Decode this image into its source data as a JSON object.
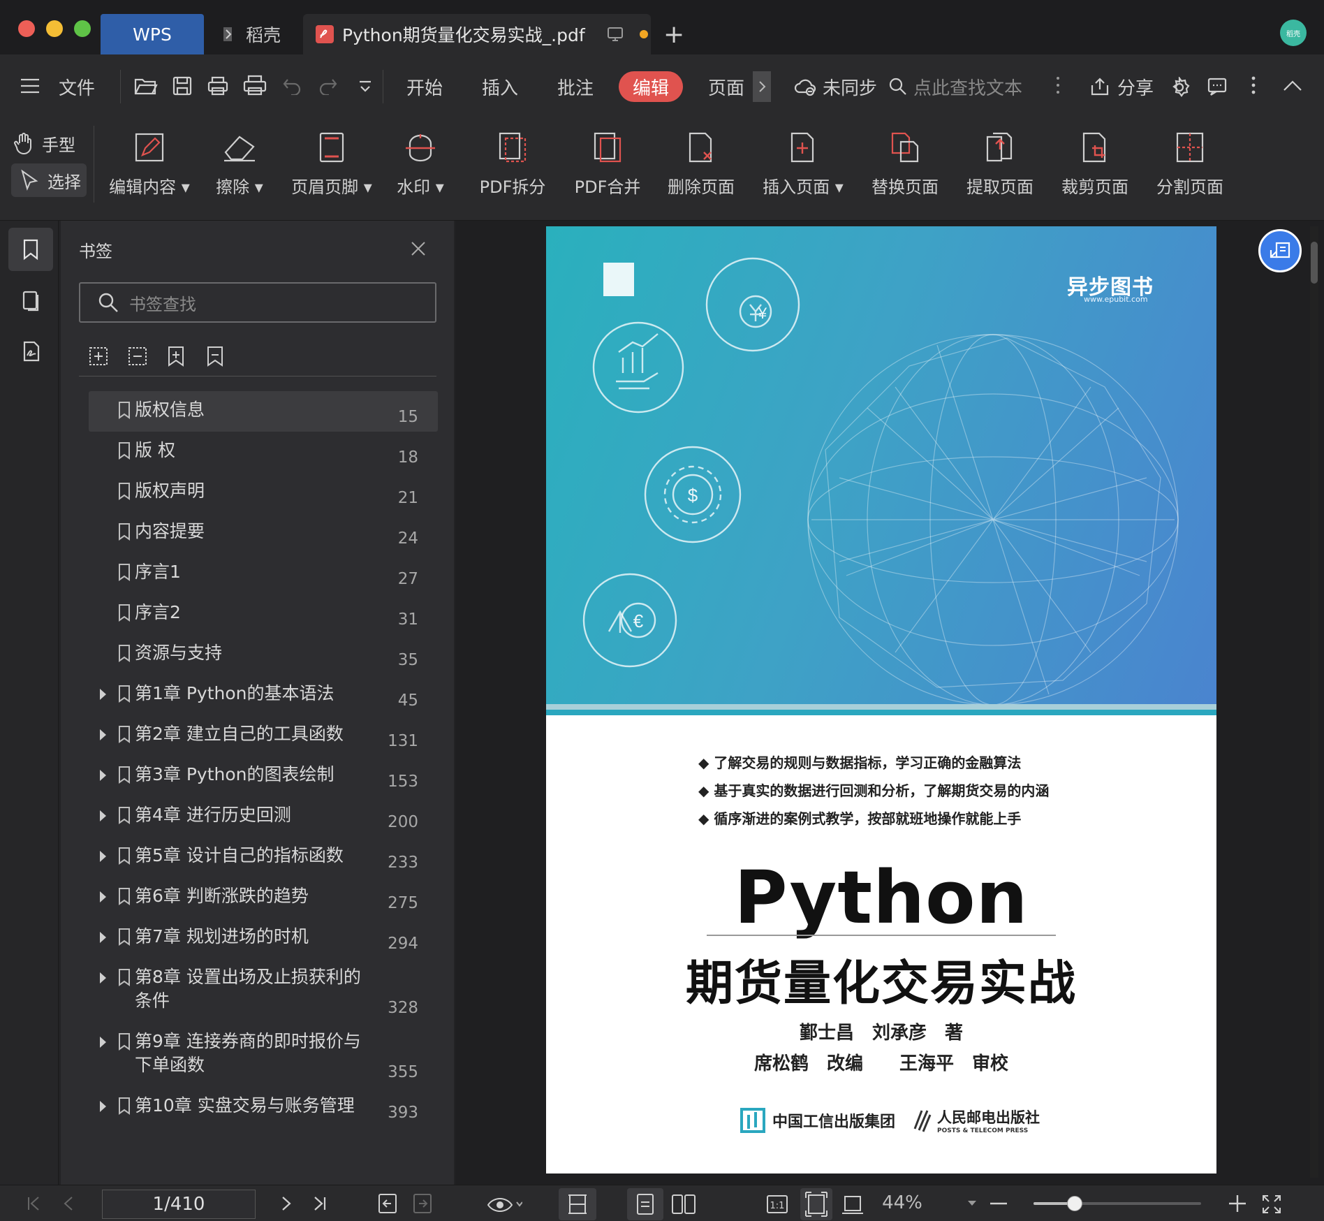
{
  "titlebar": {
    "tabs": [
      {
        "label": "WPS"
      },
      {
        "label": "稻壳"
      },
      {
        "label": "Python期货量化交易实战_.pdf"
      }
    ],
    "new_tab": "+",
    "avatar_text": "稻壳"
  },
  "menubar": {
    "file": "文件",
    "start": "开始",
    "insert": "插入",
    "comment": "批注",
    "edit": "编辑",
    "page": "页面",
    "sync": "未同步",
    "search_placeholder": "点此查找文本",
    "share": "分享"
  },
  "ribbon": {
    "hand": "手型",
    "select": "选择",
    "tools": [
      {
        "label": "编辑内容"
      },
      {
        "label": "擦除"
      },
      {
        "label": "页眉页脚"
      },
      {
        "label": "水印"
      },
      {
        "label": "PDF拆分"
      },
      {
        "label": "PDF合并"
      },
      {
        "label": "删除页面"
      },
      {
        "label": "插入页面"
      },
      {
        "label": "替换页面"
      },
      {
        "label": "提取页面"
      },
      {
        "label": "裁剪页面"
      },
      {
        "label": "分割页面"
      }
    ]
  },
  "bookmarks": {
    "title": "书签",
    "search_placeholder": "书签查找",
    "items": [
      {
        "label": "版权信息",
        "page": "15"
      },
      {
        "label": "版 权",
        "page": "18"
      },
      {
        "label": "版权声明",
        "page": "21"
      },
      {
        "label": "内容提要",
        "page": "24"
      },
      {
        "label": "序言1",
        "page": "27"
      },
      {
        "label": "序言2",
        "page": "31"
      },
      {
        "label": "资源与支持",
        "page": "35"
      },
      {
        "label": "第1章 Python的基本语法",
        "page": "45"
      },
      {
        "label": "第2章 建立自己的工具函数",
        "page": "131"
      },
      {
        "label": "第3章 Python的图表绘制",
        "page": "153"
      },
      {
        "label": "第4章 进行历史回测",
        "page": "200"
      },
      {
        "label": "第5章 设计自己的指标函数",
        "page": "233"
      },
      {
        "label": "第6章 判断涨跌的趋势",
        "page": "275"
      },
      {
        "label": "第7章 规划进场的时机",
        "page": "294"
      },
      {
        "label": "第8章 设置出场及止损获利的",
        "label2": "条件",
        "page": "328"
      },
      {
        "label": "第9章 连接券商的即时报价与",
        "label2": "下单函数",
        "page": "355"
      },
      {
        "label": "第10章 实盘交易与账务管理",
        "page": "393"
      }
    ]
  },
  "cover": {
    "publisher_logo": "异步图书",
    "publisher_url": "www.epubit.com",
    "bullets": [
      "了解交易的规则与数据指标，学习正确的金融算法",
      "基于真实的数据进行回测和分析，了解期货交易的内涵",
      "循序渐进的案例式教学，按部就班地操作就能上手"
    ],
    "title_en": "Python",
    "title_cn": "期货量化交易实战",
    "authors_line1": "鄞士昌　刘承彦　著",
    "authors_line2": "席松鹤　改编　　王海平　审校",
    "press1": "中国工信出版集团",
    "press2": "人民邮电出版社",
    "press2_en": "POSTS & TELECOM PRESS"
  },
  "status": {
    "page_indicator": "1/410",
    "zoom": "44%",
    "zoom_level": 0.44
  },
  "colors": {
    "accent_red": "#e0534f",
    "wps_tab": "#2f5ea8",
    "cover_teal": "#2aa7bf",
    "cover_blue": "#4a7fcf"
  }
}
